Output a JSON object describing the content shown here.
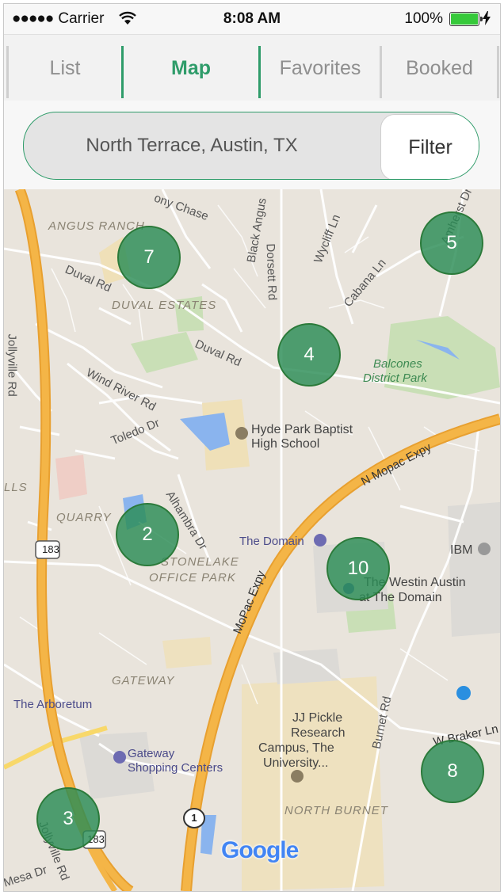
{
  "status_bar": {
    "carrier": "Carrier",
    "time": "8:08 AM",
    "battery": "100%"
  },
  "tabs": [
    {
      "label": "List"
    },
    {
      "label": "Map",
      "active": true
    },
    {
      "label": "Favorites"
    },
    {
      "label": "Booked"
    }
  ],
  "search": {
    "value": "North Terrace, Austin, TX",
    "filter_label": "Filter"
  },
  "map": {
    "clusters": [
      {
        "count": "7"
      },
      {
        "count": "5"
      },
      {
        "count": "4"
      },
      {
        "count": "2"
      },
      {
        "count": "10"
      },
      {
        "count": "8"
      },
      {
        "count": "3"
      }
    ],
    "labels": {
      "angus_ranch": "ANGUS RANCH",
      "duval_estates": "DUVAL ESTATES",
      "quarry": "QUARRY",
      "stonelake": "STONELAKE",
      "office_park": "OFFICE PARK",
      "gateway": "GATEWAY",
      "north_burnet": "NORTH BURNET",
      "lls": "LLS",
      "balcones_1": "Balcones",
      "balcones_2": "District Park",
      "hyde_1": "Hyde Park Baptist",
      "hyde_2": "High School",
      "the_domain": "The Domain",
      "westin_1": "The Westin Austin",
      "westin_2": "at The Domain",
      "ibm": "IBM",
      "arboretum": "The Arboretum",
      "gateway_sc_1": "Gateway",
      "gateway_sc_2": "Shopping Centers",
      "jj_1": "JJ Pickle",
      "jj_2": "Research",
      "jj_3": "Campus, The",
      "jj_4": "University...",
      "duval_rd_1": "Duval Rd",
      "duval_rd_2": "Duval Rd",
      "wind_river": "Wind River Rd",
      "toledo": "Toledo Dr",
      "alhambra": "Alhambra Dr",
      "jollyville": "Jollyville Rd",
      "jollyville_2": "Jollyville Rd",
      "black_angus": "Black Angus",
      "dorsett": "Dorsett Rd",
      "wycliff": "Wycliff Ln",
      "cabana": "Cabana Ln",
      "amherst": "Amherst Dr",
      "pony_chase": "ony Chase",
      "n_mopac": "N Mopac Expy",
      "mopac": "MoPac Expy",
      "burnet": "Burnet Rd",
      "braker": "W Braker Ln",
      "mesa": "Mesa Dr",
      "hwy183": "183",
      "hwy183b": "183",
      "hwy1": "1"
    },
    "google_logo": "Google"
  }
}
